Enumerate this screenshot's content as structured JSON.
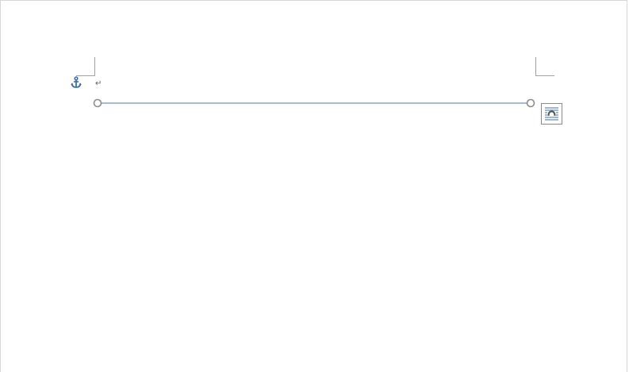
{
  "document": {
    "paragraph_mark": "↵"
  },
  "icons": {
    "anchor": "anchor-icon",
    "layout_options": "layout-options-icon",
    "paragraph_mark": "paragraph-mark"
  },
  "colors": {
    "line": "#4a7ab5",
    "handle": "#8c8c8c",
    "anchor": "#3f6fa8",
    "crop_marks": "#a0a0a0"
  }
}
